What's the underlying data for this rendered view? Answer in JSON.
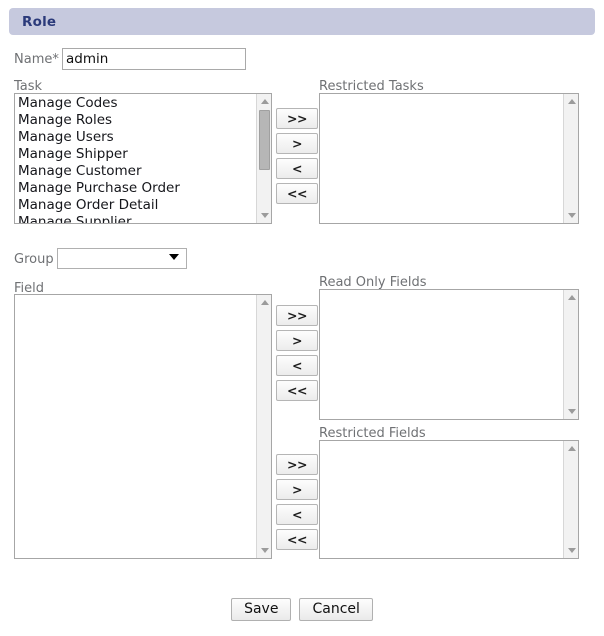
{
  "header": {
    "title": "Role",
    "bg_color": "#c6c9de",
    "text_color": "#2b3a7a"
  },
  "form": {
    "name": {
      "label": "Name",
      "required_marker": "*",
      "value": "admin",
      "placeholder": ""
    },
    "group": {
      "label": "Group",
      "value": "",
      "options": [
        ""
      ]
    }
  },
  "lists": {
    "task": {
      "label": "Task",
      "items": [
        "Manage Codes",
        "Manage Roles",
        "Manage Users",
        "Manage Shipper",
        "Manage Customer",
        "Manage Purchase Order",
        "Manage Order Detail",
        "Manage Supplier"
      ]
    },
    "restricted_tasks": {
      "label": "Restricted Tasks",
      "items": []
    },
    "field": {
      "label": "Field",
      "items": []
    },
    "read_only_fields": {
      "label": "Read Only Fields",
      "items": []
    },
    "restricted_fields": {
      "label": "Restricted Fields",
      "items": []
    }
  },
  "transfer_buttons": {
    "add_all": ">>",
    "add_one": ">",
    "remove_one": "<",
    "remove_all": "<<"
  },
  "footer": {
    "save_label": "Save",
    "cancel_label": "Cancel"
  }
}
